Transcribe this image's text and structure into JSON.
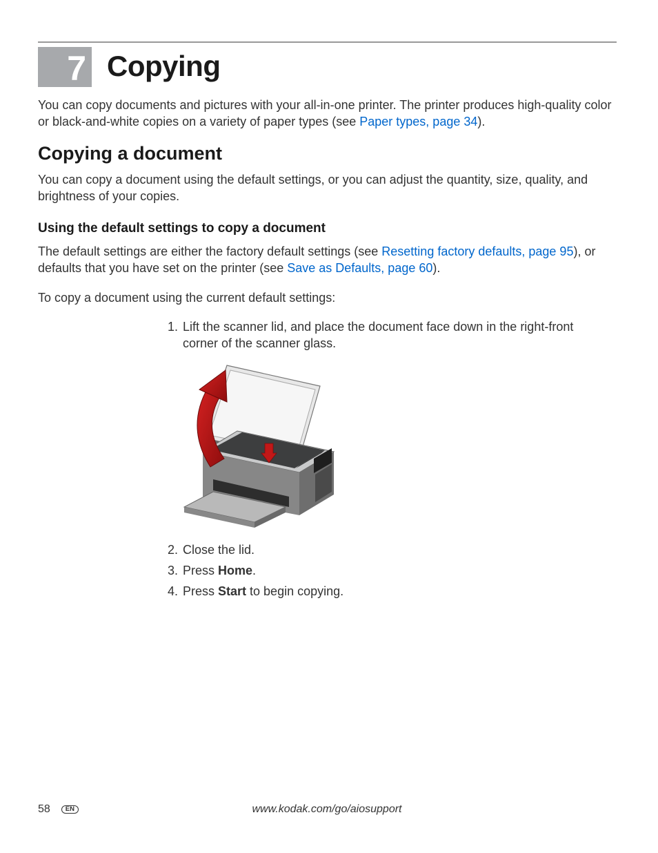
{
  "chapter": {
    "number": "7",
    "title": "Copying"
  },
  "intro": {
    "p1a": "You can copy documents and pictures with your all-in-one printer. The printer produces high-quality color or black-and-white copies on a variety of paper types (see ",
    "link1": "Paper types, page 34",
    "p1b": ")."
  },
  "section1": {
    "title": "Copying a document",
    "p1": "You can copy a document using the default settings, or you can adjust the quantity, size, quality, and brightness of your copies."
  },
  "section2": {
    "title": "Using the default settings to copy a document",
    "p1a": "The default settings are either the factory default settings (see ",
    "link1": "Resetting factory defaults, page 95",
    "p1b": "), or defaults that you have set on the printer (see ",
    "link2": "Save as Defaults, page 60",
    "p1c": ").",
    "p2": "To copy a document using the current default settings:",
    "steps": {
      "s1": "Lift the scanner lid, and place the document face down in the right-front corner of the scanner glass.",
      "s2": "Close the lid.",
      "s3a": "Press ",
      "s3b": "Home",
      "s3c": ".",
      "s4a": "Press ",
      "s4b": "Start",
      "s4c": " to begin copying."
    }
  },
  "footer": {
    "page": "58",
    "lang": "EN",
    "url": "www.kodak.com/go/aiosupport"
  }
}
